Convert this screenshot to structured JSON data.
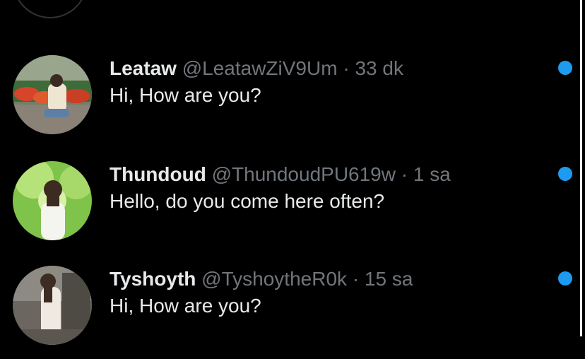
{
  "colors": {
    "background": "#000000",
    "primary_text": "#e7e9ea",
    "secondary_text": "#71767b",
    "unread_indicator": "#1d9bf0"
  },
  "conversations": [
    {
      "name": "Leataw",
      "handle": "@LeatawZiV9Um",
      "separator": "·",
      "time": "33 dk",
      "message": "Hi, How are you?",
      "unread": true
    },
    {
      "name": "Thundoud",
      "handle": "@ThundoudPU619w",
      "separator": "·",
      "time": "1 sa",
      "message": "Hello, do you come here often?",
      "unread": true
    },
    {
      "name": "Tyshoyth",
      "handle": "@TyshoytheR0k",
      "separator": "·",
      "time": "15 sa",
      "message": "Hi, How are you?",
      "unread": true
    }
  ]
}
